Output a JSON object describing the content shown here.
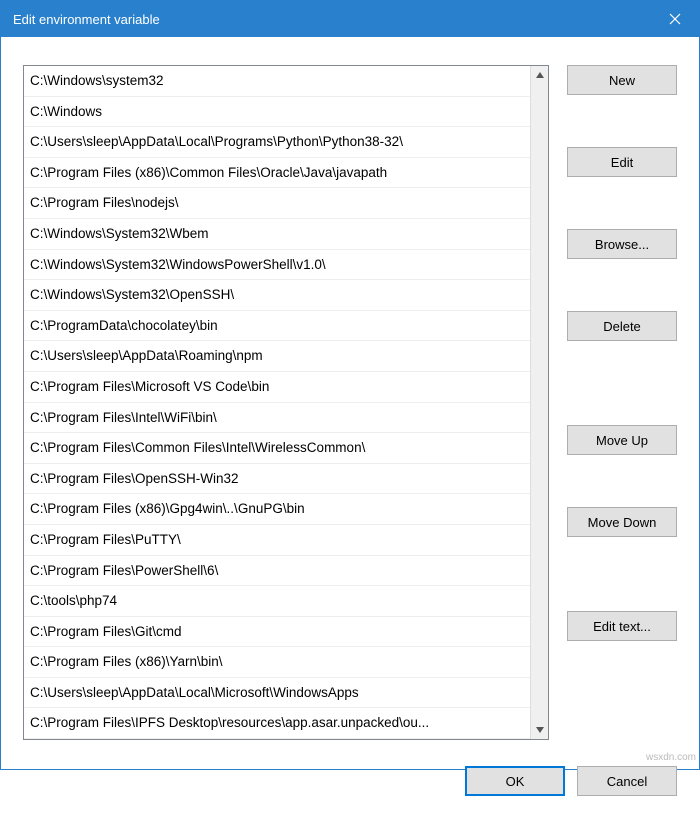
{
  "window": {
    "title": "Edit environment variable"
  },
  "paths": [
    "C:\\Windows\\system32",
    "C:\\Windows",
    "C:\\Users\\sleep\\AppData\\Local\\Programs\\Python\\Python38-32\\",
    "C:\\Program Files (x86)\\Common Files\\Oracle\\Java\\javapath",
    "C:\\Program Files\\nodejs\\",
    "C:\\Windows\\System32\\Wbem",
    "C:\\Windows\\System32\\WindowsPowerShell\\v1.0\\",
    "C:\\Windows\\System32\\OpenSSH\\",
    "C:\\ProgramData\\chocolatey\\bin",
    "C:\\Users\\sleep\\AppData\\Roaming\\npm",
    "C:\\Program Files\\Microsoft VS Code\\bin",
    "C:\\Program Files\\Intel\\WiFi\\bin\\",
    "C:\\Program Files\\Common Files\\Intel\\WirelessCommon\\",
    "C:\\Program Files\\OpenSSH-Win32",
    "C:\\Program Files (x86)\\Gpg4win\\..\\GnuPG\\bin",
    "C:\\Program Files\\PuTTY\\",
    "C:\\Program Files\\PowerShell\\6\\",
    "C:\\tools\\php74",
    "C:\\Program Files\\Git\\cmd",
    "C:\\Program Files (x86)\\Yarn\\bin\\",
    "C:\\Users\\sleep\\AppData\\Local\\Microsoft\\WindowsApps",
    "C:\\Program Files\\IPFS Desktop\\resources\\app.asar.unpacked\\ou..."
  ],
  "buttons": {
    "new": "New",
    "edit": "Edit",
    "browse": "Browse...",
    "delete": "Delete",
    "moveUp": "Move Up",
    "moveDown": "Move Down",
    "editText": "Edit text...",
    "ok": "OK",
    "cancel": "Cancel"
  },
  "watermark": "wsxdn.com"
}
